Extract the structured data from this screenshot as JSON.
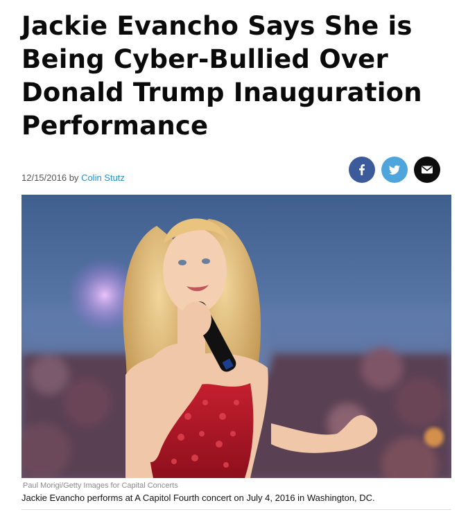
{
  "article": {
    "headline": "Jackie Evancho Says She is Being Cyber-Bullied Over Donald Trump Inauguration Performance",
    "date": "12/15/2016",
    "by": "by",
    "author": "Colin Stutz"
  },
  "share": {
    "icons": [
      "facebook-icon",
      "twitter-icon",
      "email-icon"
    ],
    "colors": {
      "facebook": "#3b5b9a",
      "twitter": "#4ea5dc",
      "email": "#0d0d0d"
    }
  },
  "photo": {
    "credit": "Paul Morigi/Getty Images for Capital Concerts",
    "caption": "Jackie Evancho performs at A Capitol Fourth concert on July 4, 2016 in Washington, DC."
  },
  "colors": {
    "author_link": "#2a8fc4"
  }
}
